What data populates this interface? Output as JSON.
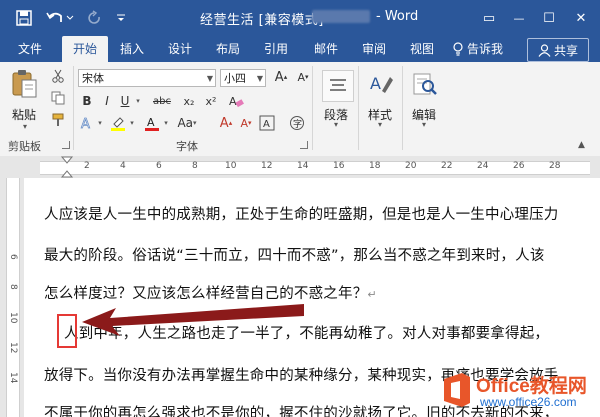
{
  "window": {
    "title": "经营生活 [兼容模式]",
    "title_suffix": "- Word",
    "controls": {
      "ribbon_display": "▭",
      "minimize": "—",
      "maximize": "☐",
      "close": "✕"
    }
  },
  "tabs": [
    {
      "label": "文件",
      "active": false
    },
    {
      "label": "开始",
      "active": true
    },
    {
      "label": "插入",
      "active": false
    },
    {
      "label": "设计",
      "active": false
    },
    {
      "label": "布局",
      "active": false
    },
    {
      "label": "引用",
      "active": false
    },
    {
      "label": "邮件",
      "active": false
    },
    {
      "label": "审阅",
      "active": false
    },
    {
      "label": "视图",
      "active": false
    }
  ],
  "tell_me": "告诉我",
  "share": "共享",
  "ribbon": {
    "clipboard": {
      "paste": "粘贴",
      "label": "剪贴板"
    },
    "font": {
      "label": "字体",
      "font_name": "宋体",
      "font_size": "小四",
      "buttons": [
        "B",
        "I",
        "U",
        "abc",
        "x₂",
        "x²"
      ]
    },
    "paragraph": {
      "label": "段落"
    },
    "styles": {
      "label": "样式"
    },
    "editing": {
      "label": "编辑"
    }
  },
  "ruler": {
    "h_numbers": [
      "2",
      "4",
      "6",
      "8",
      "10",
      "12",
      "14",
      "16",
      "18",
      "20",
      "22",
      "24",
      "26",
      "28"
    ],
    "v_numbers": [
      "6",
      "8",
      "10",
      "12",
      "14"
    ]
  },
  "document": {
    "lines": [
      {
        "text": "人应该是人一生中的成熟期，正处于生命的旺盛期，但是也是人一生中心理压力",
        "mark": ""
      },
      {
        "text": "最大的阶段。俗话说“三十而立，四十而不惑”，那么当不惑之年到来时，人该",
        "mark": ""
      },
      {
        "text": "怎么样度过？又应该怎么样经营自己的不惑之年？",
        "mark": "↵"
      },
      {
        "text": "人到中年，人生之路也走了一半了，不能再幼稚了。对人对事都要拿得起，",
        "mark": ""
      },
      {
        "text": "放得下。当你没有办法再掌握生命中的某种缘分，某种现实，再痛也要学会放手",
        "mark": ""
      },
      {
        "text": "不属于你的再怎么强求也不是你的，握不住的沙就扬了它。旧的不去新的不来，",
        "mark": ""
      }
    ]
  },
  "watermark": {
    "brand": "Office教程网",
    "url": "www.office26.com"
  }
}
